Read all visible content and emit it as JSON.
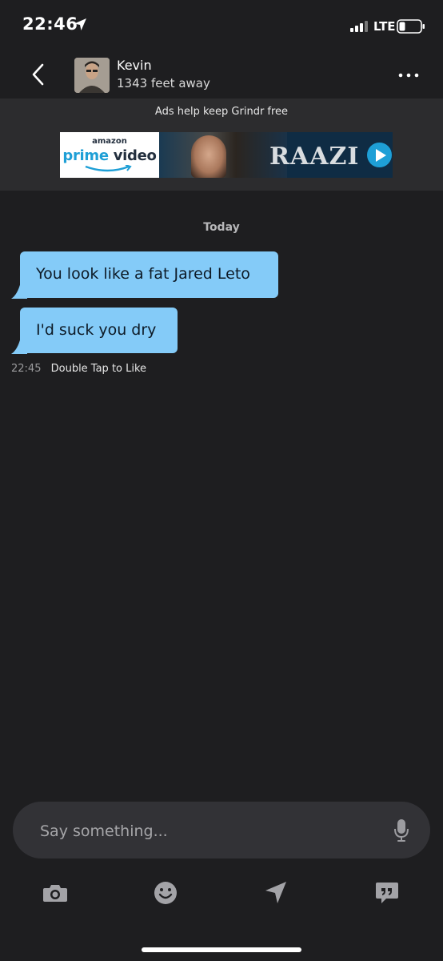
{
  "status_bar": {
    "time": "22:46",
    "network": "LTE"
  },
  "header": {
    "name": "Kevin",
    "distance": "1343 feet away"
  },
  "ad": {
    "caption": "Ads help keep Grindr free",
    "banner": {
      "amazon": "amazon",
      "prime": "prime",
      "video": "video",
      "title": "RAAZI"
    }
  },
  "chat": {
    "day_label": "Today",
    "messages": [
      {
        "text": "You look like a fat Jared Leto"
      },
      {
        "text": "I'd suck you dry"
      }
    ],
    "timestamp": "22:45",
    "like_hint": "Double Tap to Like"
  },
  "composer": {
    "placeholder": "Say something..."
  },
  "toolbar": {
    "icons": [
      "camera-icon",
      "emoji-icon",
      "location-icon",
      "saved-phrases-icon"
    ]
  },
  "colors": {
    "background": "#1e1e20",
    "bubble": "#84cbf8",
    "ad_bg": "#2c2c2e",
    "composer_bg": "#323236"
  }
}
